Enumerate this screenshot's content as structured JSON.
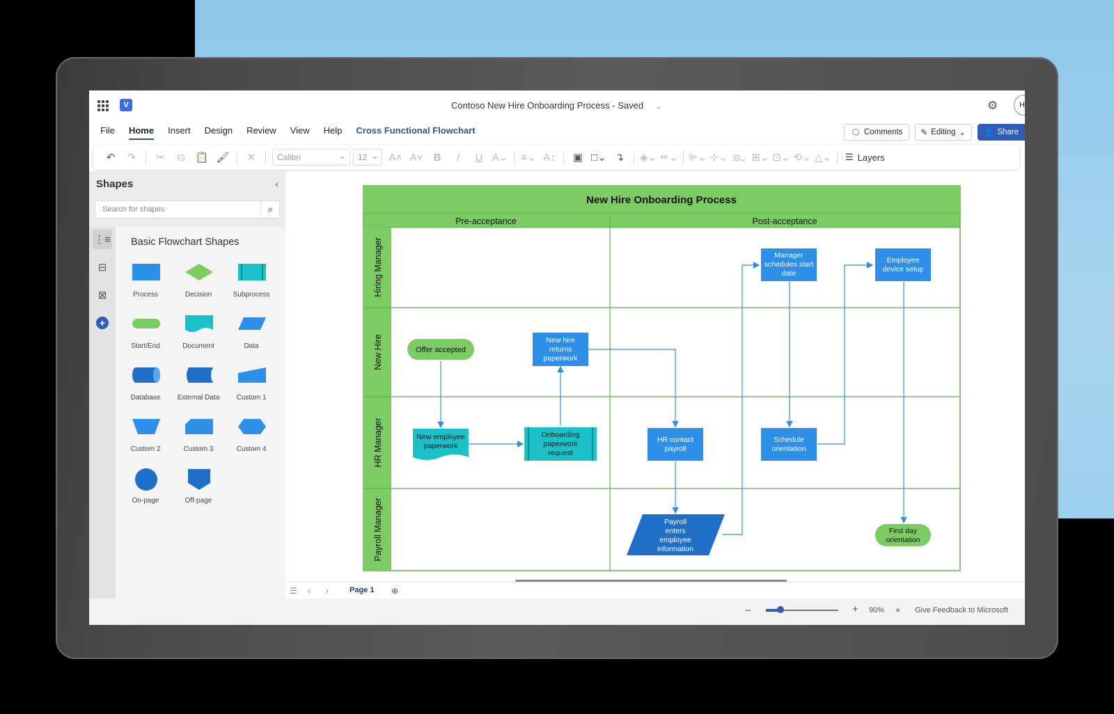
{
  "app": {
    "document_title": "Contoso New Hire Onboarding Process",
    "save_status": "Saved",
    "separator": "-",
    "avatar_initials": "HI"
  },
  "menu": {
    "items": [
      "File",
      "Home",
      "Insert",
      "Design",
      "Review",
      "View",
      "Help"
    ],
    "contextual_tab": "Cross Functional Flowchart",
    "comments_label": "Comments",
    "editing_label": "Editing",
    "share_label": "Share"
  },
  "toolbar": {
    "font_name": "Calibri",
    "font_size": "12",
    "layers_label": "Layers"
  },
  "shapes_pane": {
    "title": "Shapes",
    "search_placeholder": "Search for shapes",
    "stencil_title": "Basic Flowchart Shapes",
    "shapes": [
      {
        "label": "Process",
        "icon": "process-shape-icon"
      },
      {
        "label": "Decision",
        "icon": "decision-shape-icon"
      },
      {
        "label": "Subprocess",
        "icon": "subprocess-shape-icon"
      },
      {
        "label": "Start/End",
        "icon": "start-end-shape-icon"
      },
      {
        "label": "Document",
        "icon": "document-shape-icon"
      },
      {
        "label": "Data",
        "icon": "data-shape-icon"
      },
      {
        "label": "Database",
        "icon": "database-shape-icon"
      },
      {
        "label": "External Data",
        "icon": "external-data-shape-icon"
      },
      {
        "label": "Custom 1",
        "icon": "custom1-shape-icon"
      },
      {
        "label": "Custom 2",
        "icon": "custom2-shape-icon"
      },
      {
        "label": "Custom 3",
        "icon": "custom3-shape-icon"
      },
      {
        "label": "Custom 4",
        "icon": "custom4-shape-icon"
      },
      {
        "label": "On-page",
        "icon": "on-page-shape-icon"
      },
      {
        "label": "Off-page",
        "icon": "off-page-shape-icon"
      }
    ]
  },
  "diagram": {
    "title": "New Hire Onboarding Process",
    "phases": [
      "Pre-acceptance",
      "Post-acceptance"
    ],
    "lanes": [
      "Hiring Manager",
      "New Hire",
      "HR Manager",
      "Payroll Manager"
    ],
    "nodes": {
      "offer_accepted": "Offer accepted",
      "new_hire_returns": [
        "New hire",
        "returns",
        "paperwork"
      ],
      "new_employee_paperwork": [
        "New employee",
        "paperwork"
      ],
      "onboarding_paperwork": [
        "Onboarding",
        "paperwork",
        "request"
      ],
      "hr_contact_payroll": [
        "HR contact",
        "payroll"
      ],
      "payroll_enters": [
        "Payroll",
        "enters",
        "employee",
        "information"
      ],
      "manager_schedules": [
        "Manager",
        "schedules start",
        "date"
      ],
      "schedule_orientation": [
        "Schedule",
        "orientation"
      ],
      "employee_device_setup": [
        "Employee",
        "device setup"
      ],
      "first_day_orientation": [
        "First day",
        "orientation"
      ]
    },
    "colors": {
      "header_green": "#7dcb63",
      "lane_border": "#5cb54a",
      "process_blue": "#2e8fe8",
      "subprocess_teal": "#1cc0c9",
      "terminator_green": "#7dcb63",
      "connector": "#2e8fe8"
    }
  },
  "page_bar": {
    "page_label": "Page 1"
  },
  "status_bar": {
    "zoom": "90%",
    "zoom_fraction": 0.2,
    "feedback": "Give Feedback to Microsoft"
  }
}
